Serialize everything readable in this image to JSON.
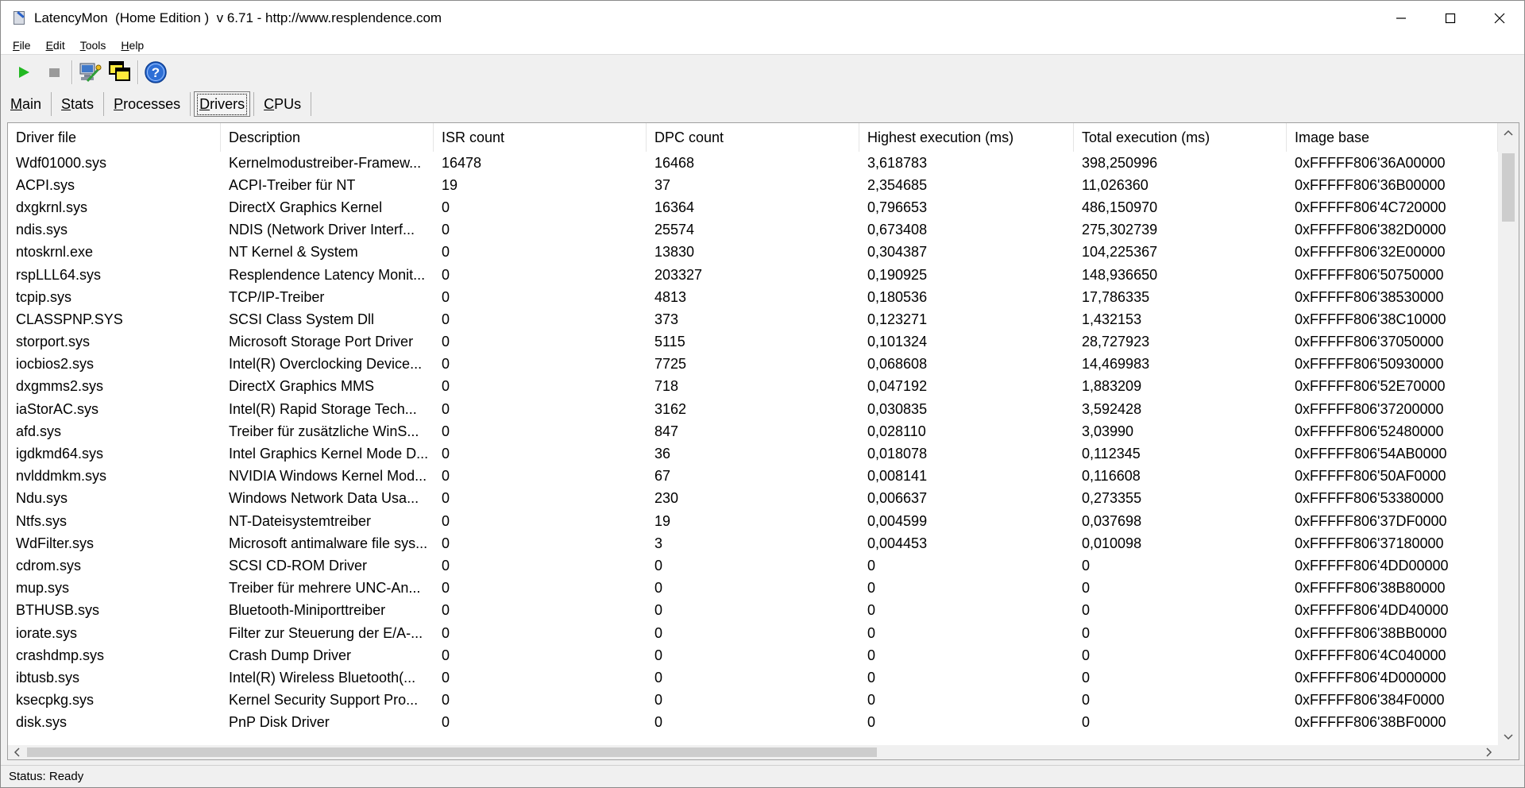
{
  "window": {
    "title": "LatencyMon  (Home Edition )  v 6.71 - http://www.resplendence.com"
  },
  "menu": {
    "items": [
      {
        "key": "F",
        "rest": "ile"
      },
      {
        "key": "E",
        "rest": "dit"
      },
      {
        "key": "T",
        "rest": "ools"
      },
      {
        "key": "H",
        "rest": "elp"
      }
    ]
  },
  "toolbar": {
    "icons": [
      "play-icon",
      "stop-icon",
      "computer-tools-icon",
      "windows-cascade-icon",
      "help-icon"
    ]
  },
  "tabs": [
    {
      "key": "M",
      "rest": "ain",
      "active": false
    },
    {
      "key": "S",
      "rest": "tats",
      "active": false
    },
    {
      "key": "P",
      "rest": "rocesses",
      "active": false
    },
    {
      "key": "D",
      "rest": "rivers",
      "active": true
    },
    {
      "key": "C",
      "rest": "PUs",
      "active": false
    }
  ],
  "table": {
    "columns": [
      "Driver file",
      "Description",
      "ISR count",
      "DPC count",
      "Highest execution (ms)",
      "Total execution (ms)",
      "Image base"
    ],
    "rows": [
      [
        "Wdf01000.sys",
        "Kernelmodustreiber-Framew...",
        "16478",
        "16468",
        "3,618783",
        "398,250996",
        "0xFFFFF806'36A00000"
      ],
      [
        "ACPI.sys",
        "ACPI-Treiber für NT",
        "19",
        "37",
        "2,354685",
        "11,026360",
        "0xFFFFF806'36B00000"
      ],
      [
        "dxgkrnl.sys",
        "DirectX Graphics Kernel",
        "0",
        "16364",
        "0,796653",
        "486,150970",
        "0xFFFFF806'4C720000"
      ],
      [
        "ndis.sys",
        "NDIS (Network Driver Interf...",
        "0",
        "25574",
        "0,673408",
        "275,302739",
        "0xFFFFF806'382D0000"
      ],
      [
        "ntoskrnl.exe",
        "NT Kernel & System",
        "0",
        "13830",
        "0,304387",
        "104,225367",
        "0xFFFFF806'32E00000"
      ],
      [
        "rspLLL64.sys",
        "Resplendence Latency Monit...",
        "0",
        "203327",
        "0,190925",
        "148,936650",
        "0xFFFFF806'50750000"
      ],
      [
        "tcpip.sys",
        "TCP/IP-Treiber",
        "0",
        "4813",
        "0,180536",
        "17,786335",
        "0xFFFFF806'38530000"
      ],
      [
        "CLASSPNP.SYS",
        "SCSI Class System Dll",
        "0",
        "373",
        "0,123271",
        "1,432153",
        "0xFFFFF806'38C10000"
      ],
      [
        "storport.sys",
        "Microsoft Storage Port Driver",
        "0",
        "5115",
        "0,101324",
        "28,727923",
        "0xFFFFF806'37050000"
      ],
      [
        "iocbios2.sys",
        "Intel(R) Overclocking Device...",
        "0",
        "7725",
        "0,068608",
        "14,469983",
        "0xFFFFF806'50930000"
      ],
      [
        "dxgmms2.sys",
        "DirectX Graphics MMS",
        "0",
        "718",
        "0,047192",
        "1,883209",
        "0xFFFFF806'52E70000"
      ],
      [
        "iaStorAC.sys",
        "Intel(R) Rapid Storage Tech...",
        "0",
        "3162",
        "0,030835",
        "3,592428",
        "0xFFFFF806'37200000"
      ],
      [
        "afd.sys",
        "Treiber für zusätzliche WinS...",
        "0",
        "847",
        "0,028110",
        "3,03990",
        "0xFFFFF806'52480000"
      ],
      [
        "igdkmd64.sys",
        "Intel Graphics Kernel Mode D...",
        "0",
        "36",
        "0,018078",
        "0,112345",
        "0xFFFFF806'54AB0000"
      ],
      [
        "nvlddmkm.sys",
        "NVIDIA Windows Kernel Mod...",
        "0",
        "67",
        "0,008141",
        "0,116608",
        "0xFFFFF806'50AF0000"
      ],
      [
        "Ndu.sys",
        "Windows Network Data Usa...",
        "0",
        "230",
        "0,006637",
        "0,273355",
        "0xFFFFF806'53380000"
      ],
      [
        "Ntfs.sys",
        "NT-Dateisystemtreiber",
        "0",
        "19",
        "0,004599",
        "0,037698",
        "0xFFFFF806'37DF0000"
      ],
      [
        "WdFilter.sys",
        "Microsoft antimalware file sys...",
        "0",
        "3",
        "0,004453",
        "0,010098",
        "0xFFFFF806'37180000"
      ],
      [
        "cdrom.sys",
        "SCSI CD-ROM Driver",
        "0",
        "0",
        "0",
        "0",
        "0xFFFFF806'4DD00000"
      ],
      [
        "mup.sys",
        "Treiber für mehrere UNC-An...",
        "0",
        "0",
        "0",
        "0",
        "0xFFFFF806'38B80000"
      ],
      [
        "BTHUSB.sys",
        "Bluetooth-Miniporttreiber",
        "0",
        "0",
        "0",
        "0",
        "0xFFFFF806'4DD40000"
      ],
      [
        "iorate.sys",
        "Filter zur Steuerung der E/A-...",
        "0",
        "0",
        "0",
        "0",
        "0xFFFFF806'38BB0000"
      ],
      [
        "crashdmp.sys",
        "Crash Dump Driver",
        "0",
        "0",
        "0",
        "0",
        "0xFFFFF806'4C040000"
      ],
      [
        "ibtusb.sys",
        "Intel(R) Wireless Bluetooth(...",
        "0",
        "0",
        "0",
        "0",
        "0xFFFFF806'4D000000"
      ],
      [
        "ksecpkg.sys",
        "Kernel Security Support Pro...",
        "0",
        "0",
        "0",
        "0",
        "0xFFFFF806'384F0000"
      ],
      [
        "disk.sys",
        "PnP Disk Driver",
        "0",
        "0",
        "0",
        "0",
        "0xFFFFF806'38BF0000"
      ]
    ]
  },
  "status": {
    "text": "Status: Ready"
  }
}
